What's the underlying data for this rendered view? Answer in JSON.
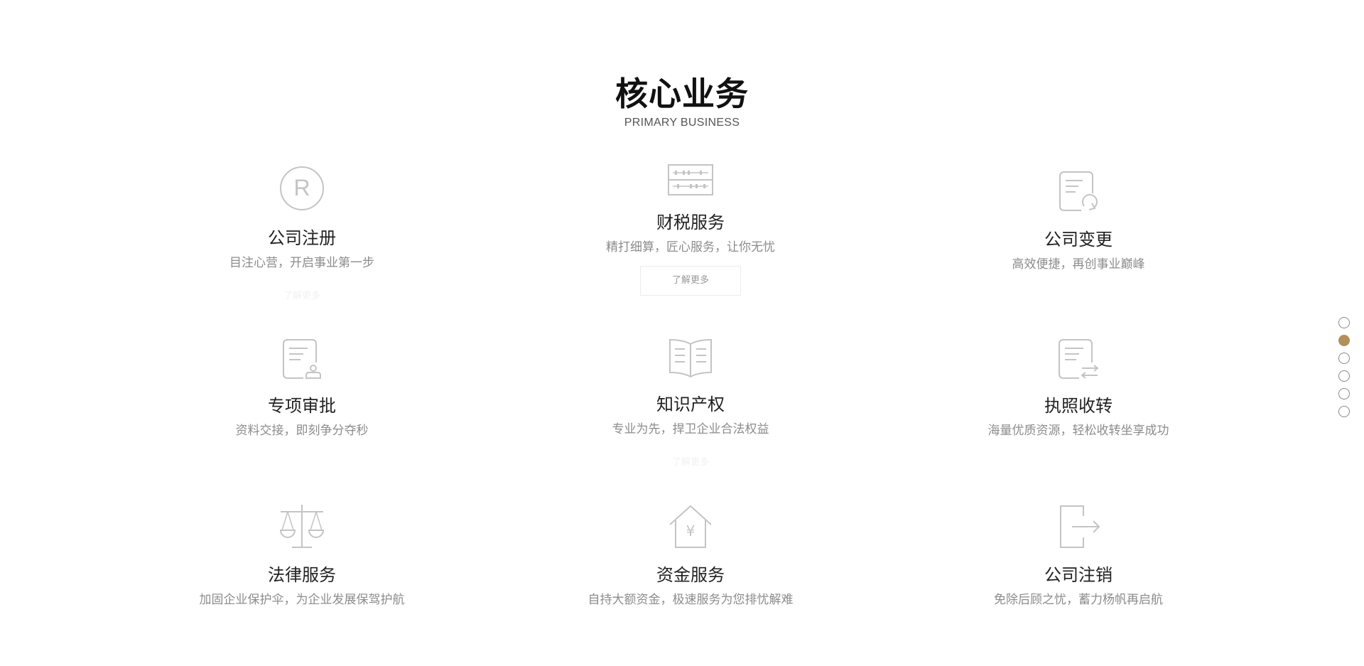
{
  "section": {
    "title": "核心业务",
    "subtitle": "PRIMARY BUSINESS"
  },
  "services": [
    {
      "icon": "registered-trademark-icon",
      "title": "公司注册",
      "desc": "目注心营，开启事业第一步",
      "more": "了解更多"
    },
    {
      "icon": "abacus-icon",
      "title": "财税服务",
      "desc": "精打细算，匠心服务，让你无忧",
      "more": "了解更多"
    },
    {
      "icon": "document-refresh-icon",
      "title": "公司变更",
      "desc": "高效便捷，再创事业巅峰",
      "more": ""
    },
    {
      "icon": "document-stamp-icon",
      "title": "专项审批",
      "desc": "资料交接，即刻争分夺秒",
      "more": ""
    },
    {
      "icon": "open-book-icon",
      "title": "知识产权",
      "desc": "专业为先，捍卫企业合法权益",
      "more": "了解更多"
    },
    {
      "icon": "document-transfer-icon",
      "title": "执照收转",
      "desc": "海量优质资源，轻松收转坐享成功",
      "more": ""
    },
    {
      "icon": "balance-scale-icon",
      "title": "法律服务",
      "desc": "加固企业保护伞，为企业发展保驾护航",
      "more": ""
    },
    {
      "icon": "house-yuan-icon",
      "title": "资金服务",
      "desc": "自持大额资金，极速服务为您排忧解难",
      "more": ""
    },
    {
      "icon": "exit-door-icon",
      "title": "公司注销",
      "desc": "免除后顾之忧，蓄力杨帆再启航",
      "more": ""
    }
  ],
  "pagination": {
    "count": 6,
    "active_index": 1
  },
  "colors": {
    "accent": "#b3905a",
    "icon_stroke": "#c4c4c4",
    "title_text": "#222222",
    "desc_text": "#8c8c8c"
  }
}
